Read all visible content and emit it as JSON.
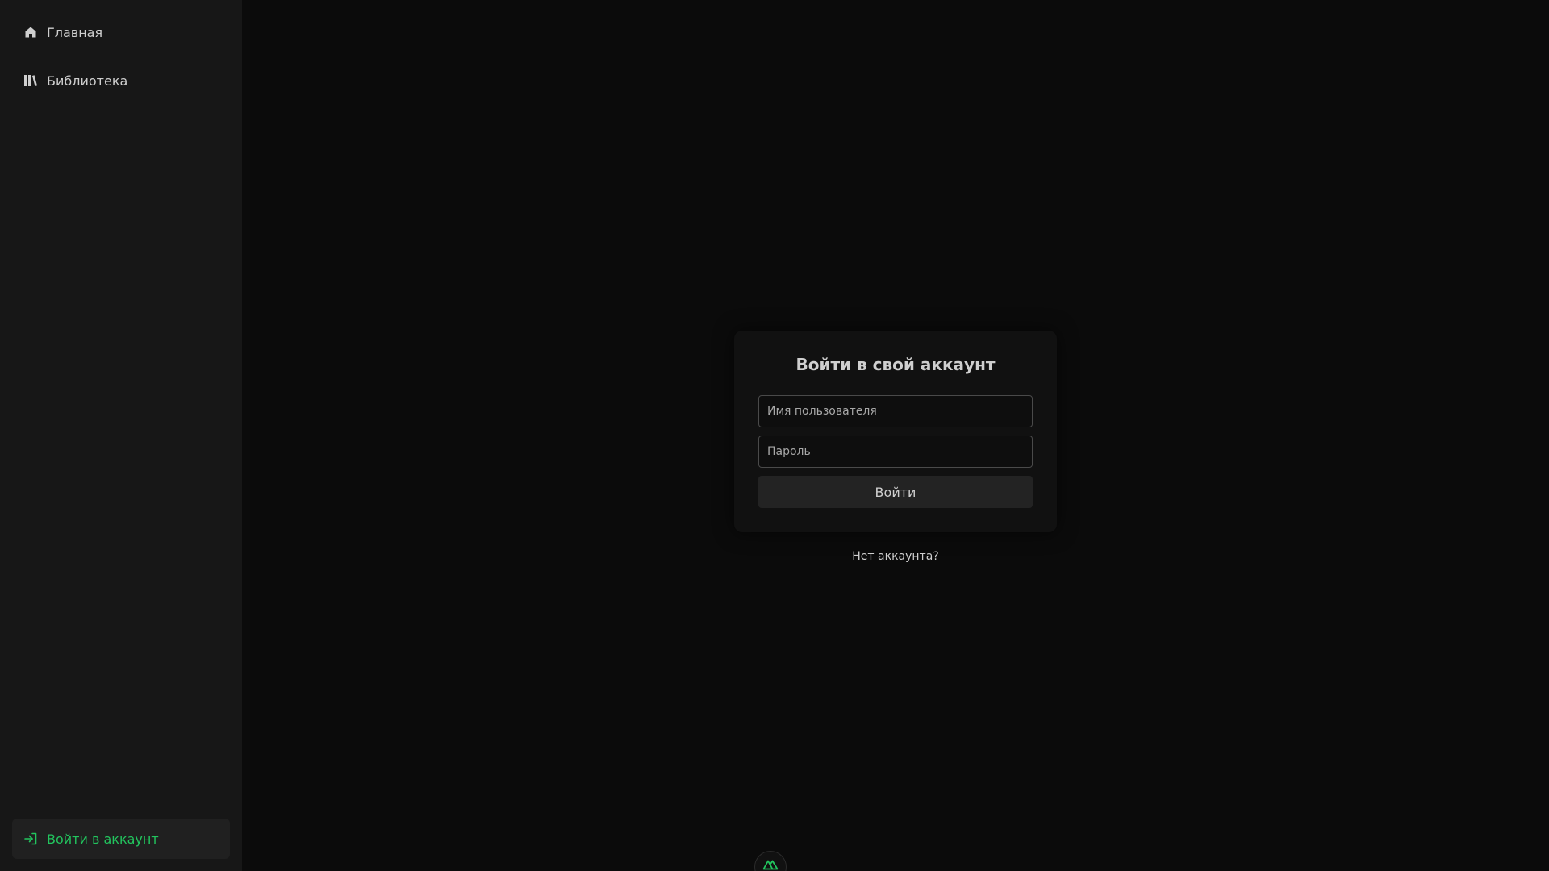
{
  "sidebar": {
    "items": [
      {
        "label": "Главная",
        "icon": "home-icon"
      },
      {
        "label": "Библиотека",
        "icon": "library-icon"
      }
    ],
    "login": {
      "label": "Войти в аккаунт",
      "icon": "sign-in-icon"
    }
  },
  "login_form": {
    "title": "Войти в свой аккаунт",
    "username_placeholder": "Имя пользователя",
    "password_placeholder": "Пароль",
    "submit_label": "Войти",
    "register_link": "Нет аккаунта?"
  },
  "colors": {
    "accent": "#22c55e",
    "sidebar_bg": "#171717",
    "main_bg": "#0b0b0b",
    "card_bg": "#111111"
  },
  "dev_badge": {
    "icon": "nuxt-logo-icon"
  }
}
